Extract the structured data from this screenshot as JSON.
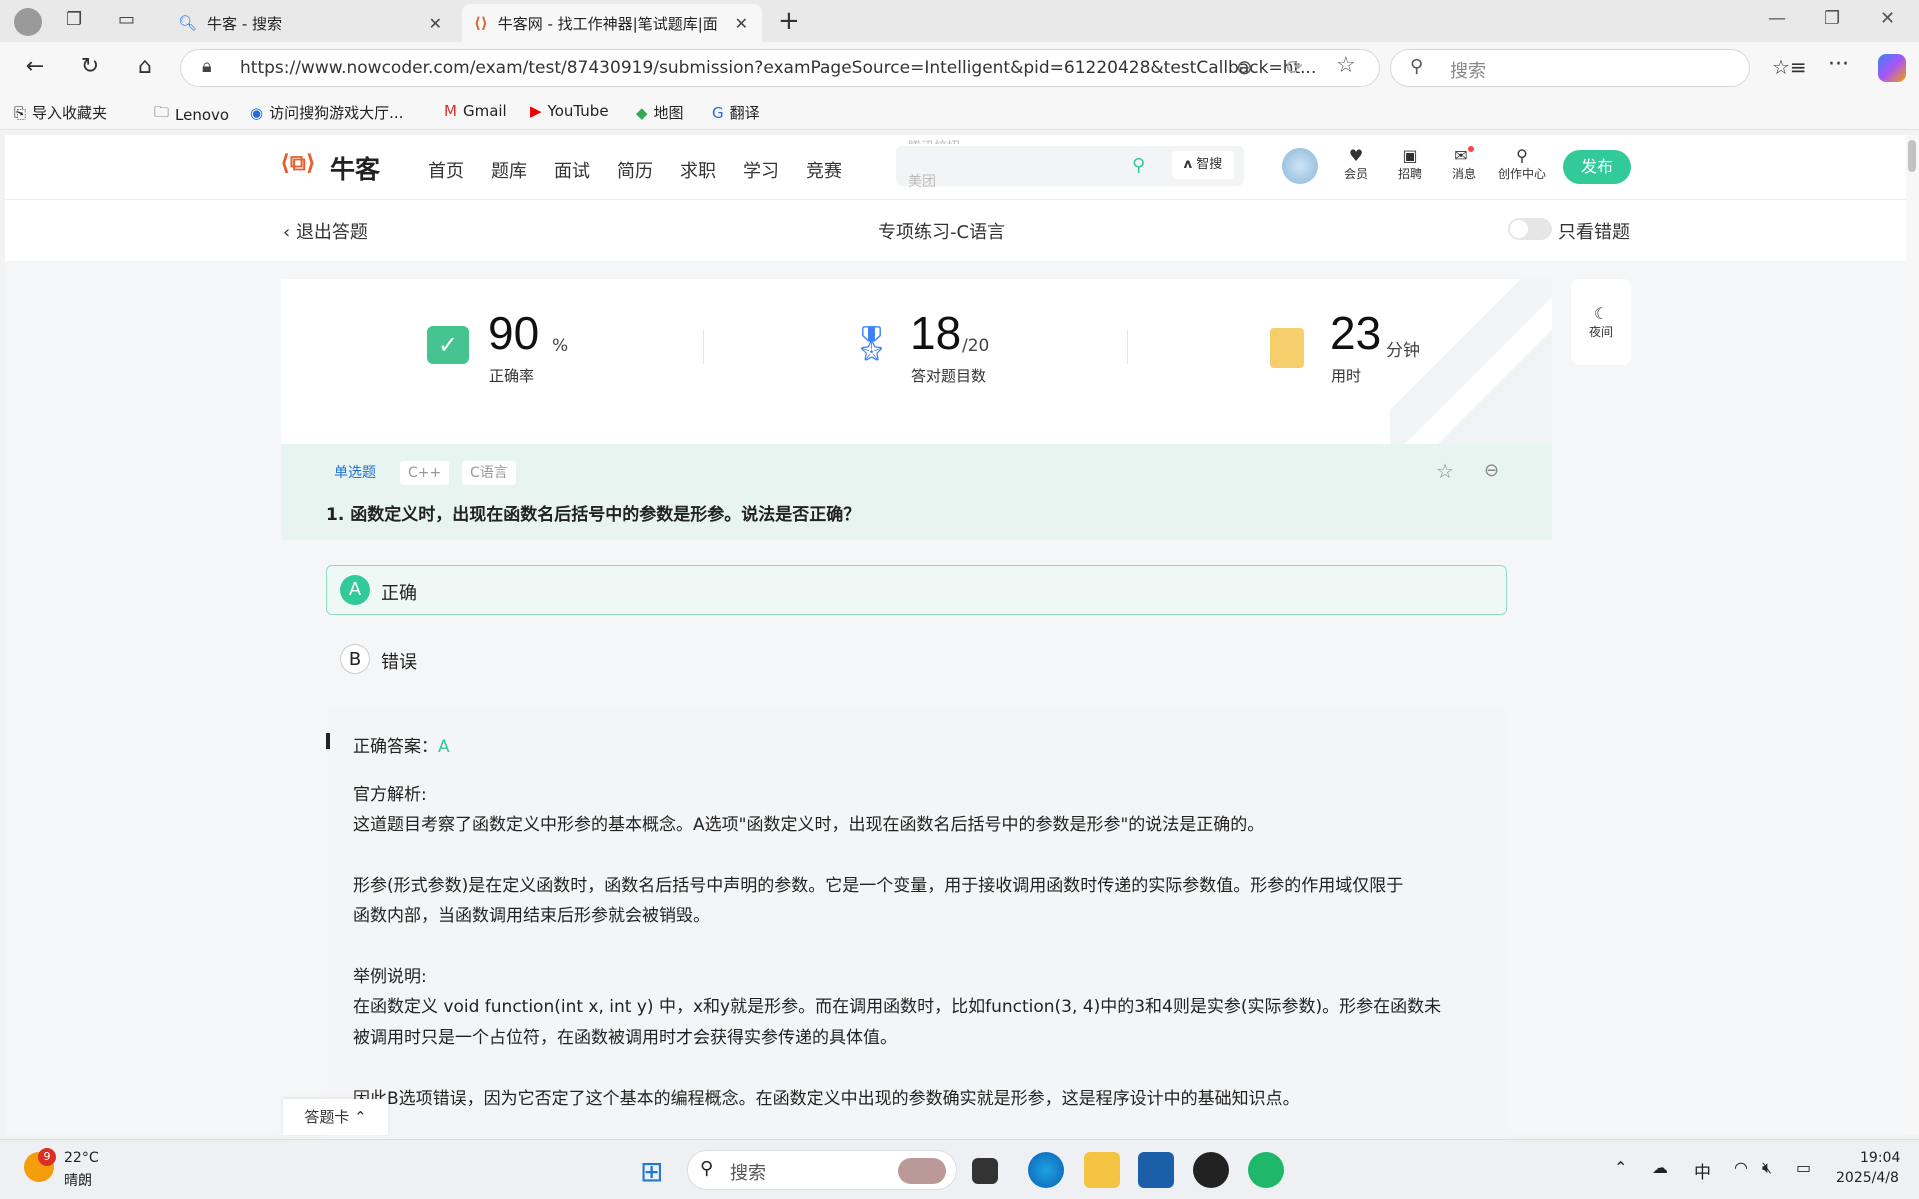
{
  "browser": {
    "tabs": [
      {
        "label": "牛客 - 搜索"
      },
      {
        "label": "牛客网 - 找工作神器|笔试题库|面试"
      }
    ],
    "url": "https://www.nowcoder.com/exam/test/87430919/submission?examPageSource=Intelligent&pid=61220428&testCallback=ht...",
    "search_placeholder": "搜索",
    "bookmarks": [
      {
        "label": "导入收藏夹",
        "icon": "import-icon"
      },
      {
        "label": "Lenovo",
        "icon": "folder-icon"
      },
      {
        "label": "访问搜狗游戏大厅...",
        "icon": "sogou-icon"
      },
      {
        "label": "Gmail",
        "icon": "gmail-icon"
      },
      {
        "label": "YouTube",
        "icon": "youtube-icon"
      },
      {
        "label": "地图",
        "icon": "maps-icon"
      },
      {
        "label": "翻译",
        "icon": "translate-icon"
      }
    ]
  },
  "site": {
    "logo_text": "牛客",
    "menu": [
      "首页",
      "题库",
      "面试",
      "简历",
      "求职",
      "学习",
      "竞赛"
    ],
    "search_hint_top": "腾讯校招",
    "search_hint": "美团",
    "zhisou": "智搜",
    "icons": [
      {
        "label": "会员",
        "icon": "vip-icon"
      },
      {
        "label": "招聘",
        "icon": "recruit-icon"
      },
      {
        "label": "消息",
        "icon": "mail-icon"
      },
      {
        "label": "创作中心",
        "icon": "bulb-icon"
      }
    ],
    "publish": "发布"
  },
  "subheader": {
    "back": "退出答题",
    "title": "专项练习-C语言",
    "toggle_label": "只看错题",
    "toggle_on": false
  },
  "stats": {
    "accuracy": {
      "value": "90",
      "unit": "%",
      "label": "正确率"
    },
    "correct": {
      "value": "18",
      "unit": "/20",
      "label": "答对题目数"
    },
    "time": {
      "value": "23",
      "unit": "分钟",
      "label": "用时"
    }
  },
  "night": "夜间",
  "question": {
    "tags": [
      "单选题",
      "C++",
      "C语言"
    ],
    "title": "1. 函数定义时，出现在函数名后括号中的参数是形参。说法是否正确？",
    "options": [
      {
        "key": "A",
        "text": "正确",
        "selected": true
      },
      {
        "key": "B",
        "text": "错误",
        "selected": false
      }
    ],
    "answer_label": "正确答案：",
    "answer_value": "A",
    "analysis_title": "官方解析:",
    "analysis": [
      "这道题目考察了函数定义中形参的基本概念。A选项\"函数定义时，出现在函数名后括号中的参数是形参\"的说法是正确的。",
      "形参(形式参数)是在定义函数时，函数名后括号中声明的参数。它是一个变量，用于接收调用函数时传递的实际参数值。形参的作用域仅限于",
      "函数内部，当函数调用结束后形参就会被销毁。",
      "举例说明:",
      "在函数定义 void function(int x, int y) 中，x和y就是形参。而在调用函数时，比如function(3, 4)中的3和4则是实参(实际参数)。形参在函数未",
      "被调用时只是一个占位符，在函数被调用时才会获得实参传递的具体值。",
      "因此B选项错误，因为它否定了这个基本的编程概念。在函数定义中出现的参数确实就是形参，这是程序设计中的基础知识点。"
    ]
  },
  "answer_card": "答题卡",
  "taskbar": {
    "weather_badge": "9",
    "temp": "22°C",
    "weather": "晴朗",
    "search": "搜索",
    "ime": "中",
    "time": "19:04",
    "date": "2025/4/8"
  },
  "colors": {
    "accent": "#32ca99",
    "tag_blue": "#1e6fd9"
  }
}
